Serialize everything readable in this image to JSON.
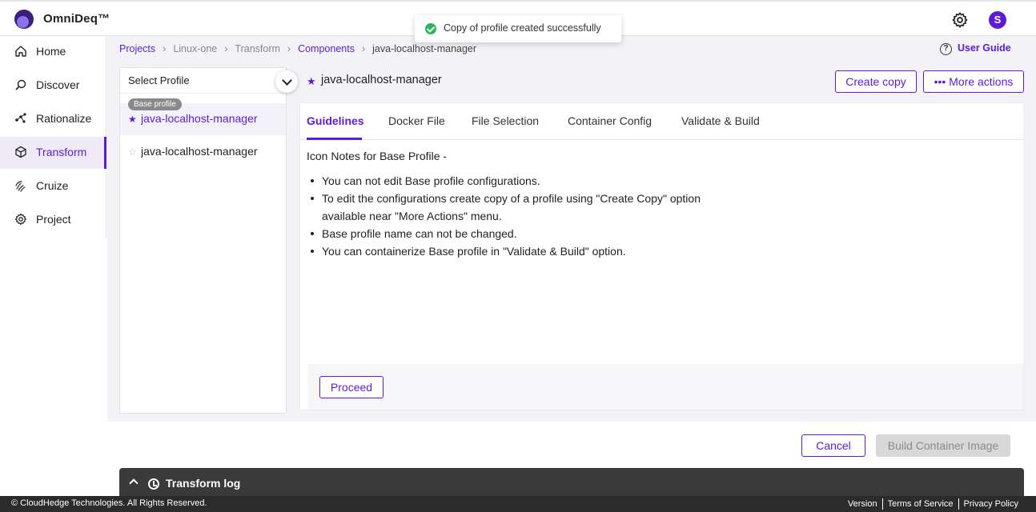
{
  "header": {
    "brand": "OmniDeq™",
    "avatar_initial": "S"
  },
  "toast": {
    "message": "Copy of profile created successfully"
  },
  "sidebar": {
    "items": [
      {
        "label": "Home",
        "icon": "home-icon"
      },
      {
        "label": "Discover",
        "icon": "discover-icon"
      },
      {
        "label": "Rationalize",
        "icon": "rationalize-icon"
      },
      {
        "label": "Transform",
        "icon": "cube-icon",
        "active": true
      },
      {
        "label": "Cruize",
        "icon": "fingerprint-icon"
      },
      {
        "label": "Project",
        "icon": "settings-icon"
      }
    ]
  },
  "breadcrumb": {
    "items": [
      "Projects",
      "Linux-one",
      "Transform",
      "Components",
      "java-localhost-manager"
    ]
  },
  "user_guide": {
    "label": "User Guide"
  },
  "profiles": {
    "select_label": "Select Profile",
    "badge": "Base profile",
    "items": [
      {
        "name": "java-localhost-manager",
        "starred": true,
        "selected": true
      },
      {
        "name": "java-localhost-manager",
        "starred": false,
        "selected": false
      }
    ]
  },
  "component": {
    "title": "java-localhost-manager",
    "create_copy": "Create copy",
    "more_actions": "••• More actions"
  },
  "tabs": {
    "items": [
      "Guidelines",
      "Docker File",
      "File Selection",
      "Container Config",
      "Validate & Build"
    ],
    "active_index": 0
  },
  "guidelines": {
    "title": "Icon Notes for Base Profile -",
    "notes": [
      "You can not edit Base profile configurations.",
      "To edit the configurations create copy of a profile using \"Create Copy\" option available near \"More Actions\" menu.",
      "Base profile name can not be changed.",
      "You can containerize Base profile in \"Validate & Build\" option."
    ],
    "proceed": "Proceed"
  },
  "actions": {
    "cancel": "Cancel",
    "build": "Build Container Image"
  },
  "log": {
    "title": "Transform log"
  },
  "footer": {
    "copyright": "© CloudHedge Technologies. All Rights Reserved.",
    "version": "Version",
    "terms": "Terms of Service",
    "privacy": "Privacy Policy"
  },
  "colors": {
    "accent": "#5b1bd9",
    "success": "#2bb55c",
    "log_bar": "#3a3a3a",
    "footer": "#2b2b2b"
  }
}
